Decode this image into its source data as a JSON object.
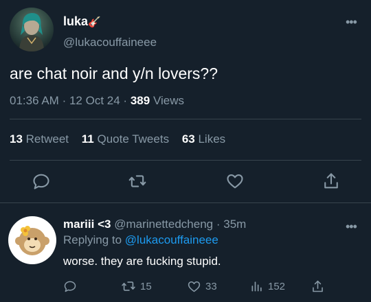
{
  "colors": {
    "background": "#15202b",
    "primary_text": "#ffffff",
    "secondary_text": "#8899a6",
    "divider": "#38444d",
    "link": "#1d9bf0"
  },
  "main_tweet": {
    "author_name": "luka",
    "author_name_emoji": "🎸",
    "author_handle": "@lukacouffaineee",
    "more_icon": "more-horizontal-icon",
    "text": "are chat noir and y/n lovers??",
    "time": "01:36 AM",
    "separator": "·",
    "date": "12 Oct 24",
    "views_count": "389",
    "views_label": "Views",
    "stats": {
      "retweets_count": "13",
      "retweets_label": "Retweet",
      "quotes_count": "11",
      "quotes_label": "Quote Tweets",
      "likes_count": "63",
      "likes_label": "Likes"
    },
    "actions": [
      "reply-icon",
      "retweet-icon",
      "like-icon",
      "share-icon"
    ]
  },
  "reply_tweet": {
    "author_name": "mariii <3",
    "author_handle": "@marinettedcheng",
    "separator": "·",
    "time_ago": "35m",
    "replying_to_label": "Replying to",
    "replying_to_handle": "@lukacouffaineee",
    "text": "worse. they are fucking stupid.",
    "more_icon": "more-horizontal-icon",
    "actions": {
      "reply_icon": "reply-icon",
      "retweets": "15",
      "likes": "33",
      "views": "152",
      "share_icon": "share-icon"
    }
  }
}
